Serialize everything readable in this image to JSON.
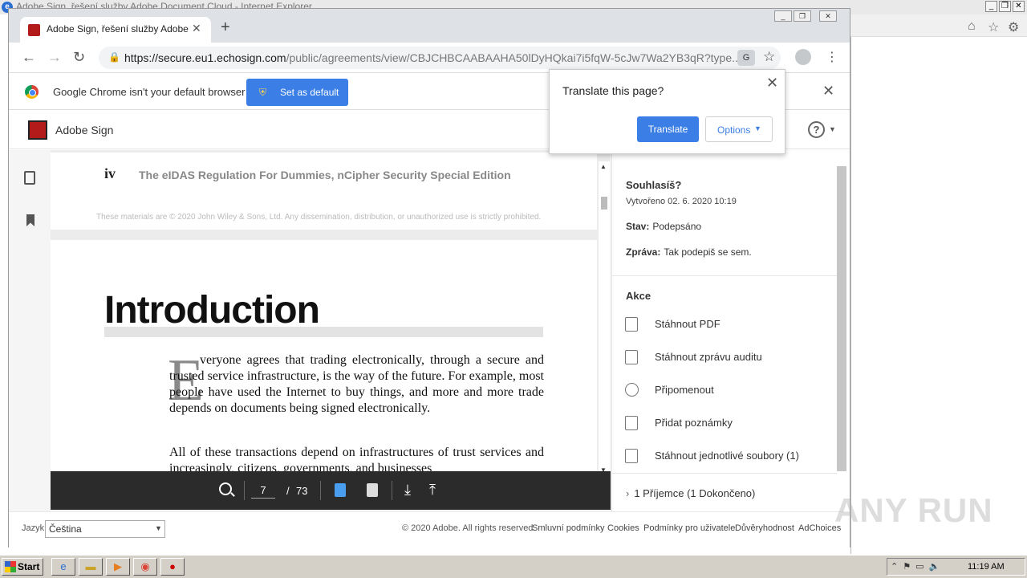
{
  "ie_window": {
    "title": "Adobe Sign, řešení služby Adobe Document Cloud - Internet Explorer",
    "controls": [
      "_",
      "❐",
      "✕"
    ],
    "toolbar_icons": [
      "home-icon",
      "star-icon",
      "gear-icon"
    ]
  },
  "chrome": {
    "tab_title": "Adobe Sign, řešení služby Adobe Do",
    "url_host": "https://secure.eu1.echosign.com",
    "url_path": "/public/agreements/view/CBJCHBCAABAAHA50lDyHQkai7i5fqW-5cJw7Wa2YB3qR?type...",
    "infobar_text": "Google Chrome isn't your default browser",
    "set_default_label": "Set as default"
  },
  "translate_popup": {
    "title": "Translate this page?",
    "translate_label": "Translate",
    "options_label": "Options"
  },
  "adobe_sign": {
    "brand": "Adobe Sign",
    "help_glyph": "?"
  },
  "document": {
    "page_roman": "iv",
    "running_title": "The eIDAS Regulation For Dummies, nCipher Security Special Edition",
    "copyright": "These materials are © 2020 John Wiley & Sons, Ltd. Any dissemination, distribution, or unauthorized use is strictly prohibited.",
    "heading": "Introduction",
    "drop_cap": "E",
    "para1": "veryone agrees that trading electronically, through a secure and trusted service infrastructure, is the way of the future. For example, most people have used the Internet to buy things, and more and more trade depends on documents being signed electronically.",
    "para2": "All of these transactions depend on infrastructures of trust services and increasingly, citizens, governments, and businesses",
    "current_page": "7",
    "page_separator": "/",
    "total_pages": "73"
  },
  "agreement": {
    "title": "Souhlasíš?",
    "created": "Vytvořeno 02. 6. 2020 10:19",
    "status_label": "Stav:",
    "status_value": "Podepsáno",
    "message_label": "Zpráva:",
    "message_value": "Tak podepiš se sem.",
    "actions_heading": "Akce",
    "actions": [
      {
        "label": "Stáhnout PDF",
        "icon": "download-pdf-icon"
      },
      {
        "label": "Stáhnout zprávu auditu",
        "icon": "download-audit-icon"
      },
      {
        "label": "Připomenout",
        "icon": "alarm-clock-icon"
      },
      {
        "label": "Přidat poznámky",
        "icon": "note-icon"
      },
      {
        "label": "Stáhnout jednotlivé soubory (1)",
        "icon": "download-files-icon"
      }
    ],
    "recipients": "1 Příjemce (1 Dokončeno)"
  },
  "footer": {
    "language_label": "Jazyk",
    "language_value": "Čeština",
    "copyright": "© 2020 Adobe. All rights reserved.",
    "links": [
      "Smluvní podmínky",
      "Cookies",
      "Podmínky pro uživatele",
      "Důvěryhodnost",
      "AdChoices"
    ]
  },
  "watermark": "ANY RUN",
  "taskbar": {
    "start_label": "Start",
    "clock": "11:19 AM"
  }
}
